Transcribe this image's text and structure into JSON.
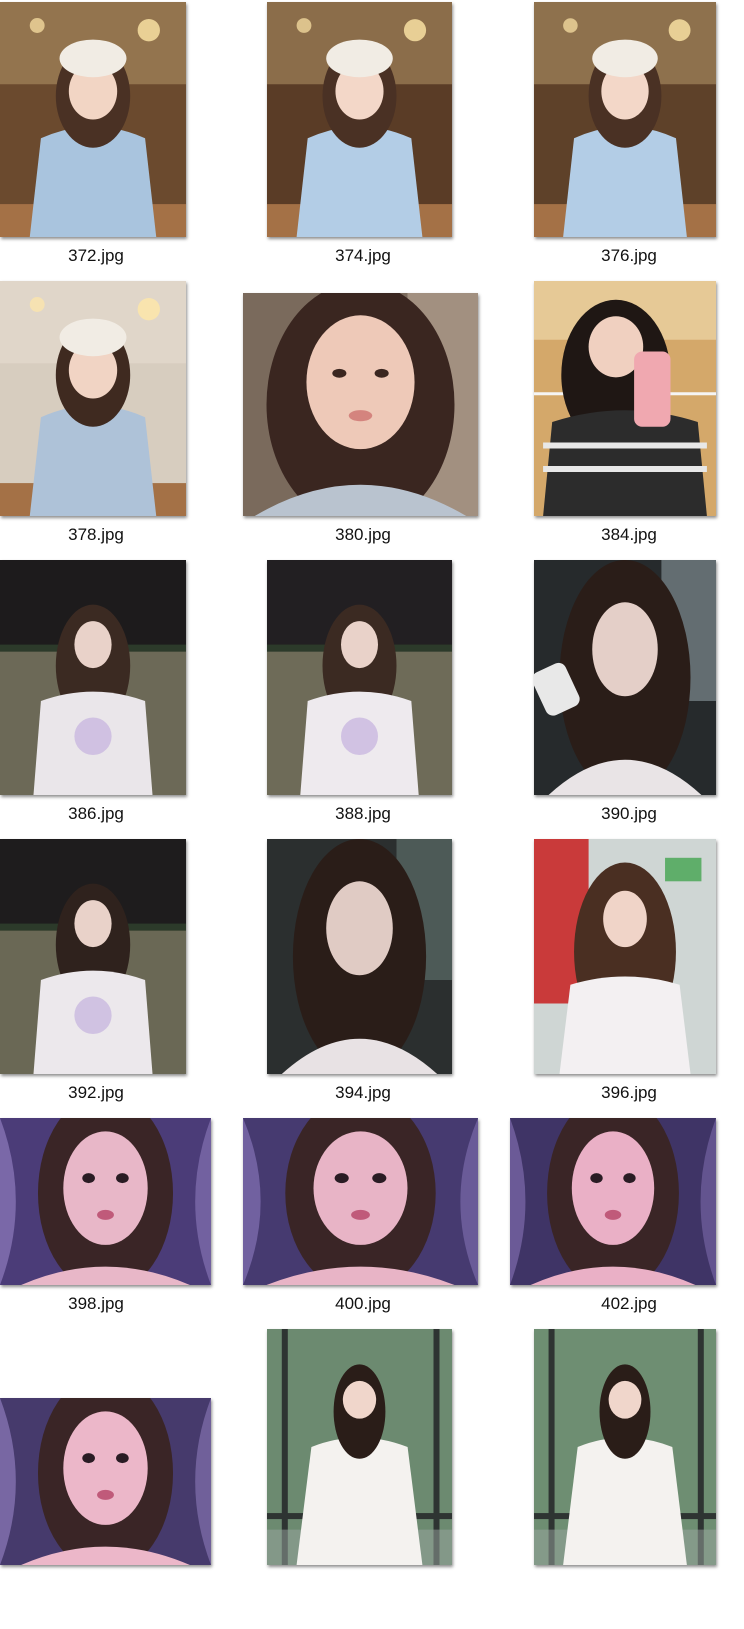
{
  "files": [
    {
      "name": "372.jpg",
      "scene": "cafe-table",
      "colors": {
        "bg": "#6b4a2e",
        "accent": "#e0c38a",
        "subject": "#a9c4de",
        "hair": "#4a3124",
        "skin": "#f2d5c4",
        "hat": "#f1ece4"
      }
    },
    {
      "name": "374.jpg",
      "scene": "cafe-table",
      "colors": {
        "bg": "#5a3c26",
        "accent": "#e8c98e",
        "subject": "#b3cde6",
        "hair": "#4a3124",
        "skin": "#f3d7c8",
        "hat": "#f1ece4"
      }
    },
    {
      "name": "376.jpg",
      "scene": "cafe-table",
      "colors": {
        "bg": "#5e4129",
        "accent": "#e8cb92",
        "subject": "#b3cde6",
        "hair": "#4a3124",
        "skin": "#f3d7c8",
        "hat": "#f1ece4"
      }
    },
    {
      "name": "378.jpg",
      "scene": "cafe-table",
      "colors": {
        "bg": "#d7cdbf",
        "accent": "#f0e8dc",
        "subject": "#aec2d8",
        "hair": "#3f2a20",
        "skin": "#f1d4c4",
        "hat": "#f1ece4"
      }
    },
    {
      "name": "380.jpg",
      "scene": "closeup",
      "colors": {
        "bg": "#7a6a5c",
        "accent": "#c9b6a4",
        "subject": "#b9c3cf",
        "hair": "#3a2620",
        "skin": "#eec9b8"
      }
    },
    {
      "name": "384.jpg",
      "scene": "mirror",
      "colors": {
        "bg": "#d4a86a",
        "accent": "#f2dfb4",
        "subject": "#2c2c2c",
        "hair": "#1f1714",
        "skin": "#f0d0c0",
        "phone": "#f0a8b0"
      }
    },
    {
      "name": "386.jpg",
      "scene": "night-field",
      "colors": {
        "bg": "#1d1b1c",
        "accent": "#6c6957",
        "subject": "#eae6ea",
        "hair": "#3b2a22",
        "skin": "#e9d2c9"
      }
    },
    {
      "name": "388.jpg",
      "scene": "night-field",
      "colors": {
        "bg": "#221f22",
        "accent": "#6e6b58",
        "subject": "#eeeaee",
        "hair": "#3b2a22",
        "skin": "#e9d2c9"
      }
    },
    {
      "name": "390.jpg",
      "scene": "night-street",
      "colors": {
        "bg": "#262a2c",
        "accent": "#7d8a8e",
        "subject": "#e9e4e6",
        "hair": "#2a1d18",
        "skin": "#e4cfc8",
        "phone": "#e8e8e8"
      }
    },
    {
      "name": "392.jpg",
      "scene": "night-field",
      "colors": {
        "bg": "#1e1c1d",
        "accent": "#6a6855",
        "subject": "#ece8ec",
        "hair": "#2f221d",
        "skin": "#e9d2c9"
      }
    },
    {
      "name": "394.jpg",
      "scene": "night-street",
      "colors": {
        "bg": "#2b2f2f",
        "accent": "#5d6c68",
        "subject": "#e8e2e4",
        "hair": "#2a1d18",
        "skin": "#e0cbc4"
      }
    },
    {
      "name": "396.jpg",
      "scene": "store",
      "colors": {
        "bg": "#c93a3a",
        "accent": "#5fae6a",
        "subject": "#f3f0f2",
        "hair": "#4a2f22",
        "skin": "#f0d4c8"
      }
    },
    {
      "name": "398.jpg",
      "scene": "purple-closeup",
      "colors": {
        "bg": "#4b3c78",
        "accent": "#9a86c8",
        "subject": "#2a1f2a",
        "hair": "#3a2526",
        "skin": "#e8b7c8"
      }
    },
    {
      "name": "400.jpg",
      "scene": "purple-closeup",
      "colors": {
        "bg": "#463a70",
        "accent": "#8e7cc0",
        "subject": "#2a1f2a",
        "hair": "#3a2526",
        "skin": "#e8b4c6"
      }
    },
    {
      "name": "402.jpg",
      "scene": "purple-closeup",
      "colors": {
        "bg": "#3f3466",
        "accent": "#8874b8",
        "subject": "#2a1f2a",
        "hair": "#3a2526",
        "skin": "#eab0c6"
      }
    },
    {
      "name": "",
      "scene": "purple-closeup",
      "colors": {
        "bg": "#463a6c",
        "accent": "#9a86c8",
        "subject": "#2a1f2a",
        "hair": "#3a2526",
        "skin": "#ecb7c9"
      }
    },
    {
      "name": "",
      "scene": "window-white",
      "colors": {
        "bg": "#6c8a70",
        "accent": "#2e3432",
        "subject": "#f4f2ef",
        "hair": "#2a1d18",
        "skin": "#f0d6cb"
      }
    },
    {
      "name": "",
      "scene": "window-white",
      "colors": {
        "bg": "#6e8e72",
        "accent": "#2e3432",
        "subject": "#f4f2ef",
        "hair": "#2a1d18",
        "skin": "#f0d6cb"
      }
    }
  ]
}
